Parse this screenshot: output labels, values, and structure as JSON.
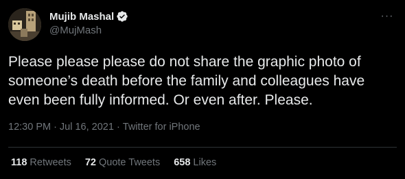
{
  "author": {
    "display_name": "Mujib Mashal",
    "handle": "@MujMash",
    "verified_icon": "verified-badge-icon",
    "verified_color": "#e7e9ea"
  },
  "more_icon": "more-horizontal-icon",
  "more_glyph": "···",
  "tweet": {
    "text": "Please please please do not share the graphic photo of someone’s death before the family and colleagues have even been fully informed. Or even after. Please."
  },
  "meta": {
    "time": "12:30 PM",
    "separator": "·",
    "date": "Jul 16, 2021",
    "source": "Twitter for iPhone"
  },
  "stats": [
    {
      "count": "118",
      "label": "Retweets"
    },
    {
      "count": "72",
      "label": "Quote Tweets"
    },
    {
      "count": "658",
      "label": "Likes"
    }
  ],
  "colors": {
    "background": "#000000",
    "primary_text": "#e7e9ea",
    "secondary_text": "#71767b",
    "divider": "#2f3336"
  }
}
